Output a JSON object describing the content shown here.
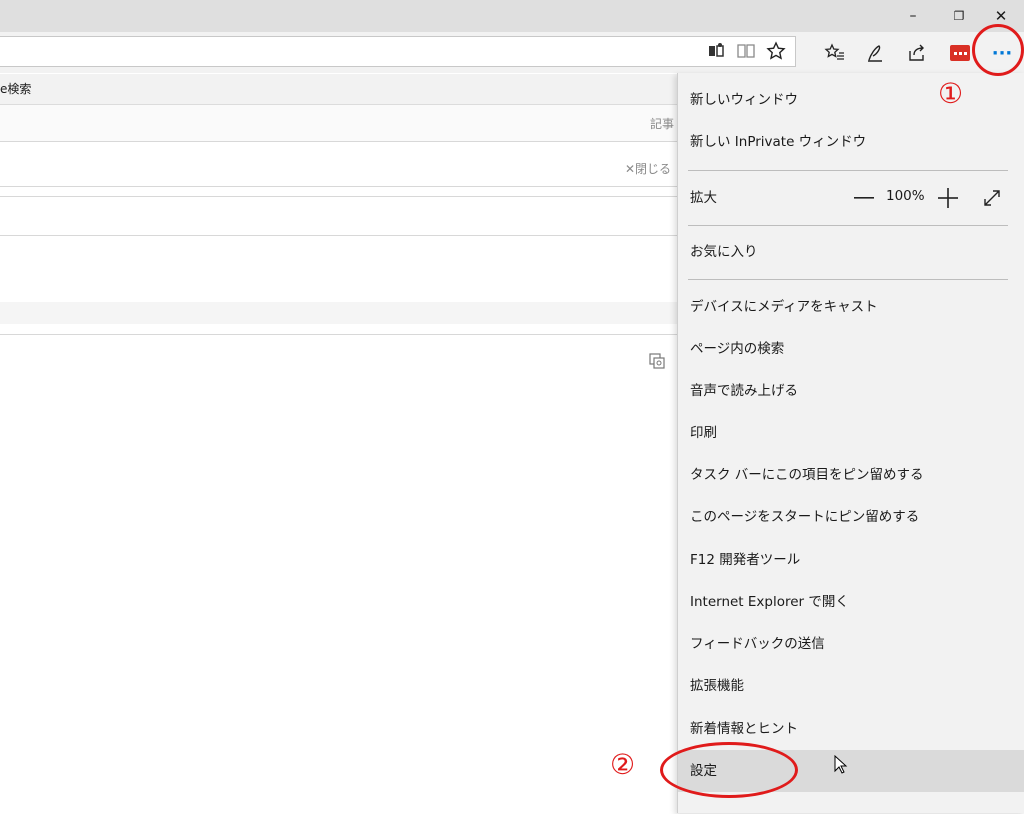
{
  "window": {
    "controls": {
      "minimize": "–",
      "restore": "❐",
      "close": "✕"
    }
  },
  "toolbar": {
    "more_label": "···",
    "icons": [
      "reading-view-icon",
      "book-icon",
      "favorite-star-icon",
      "favorites-list-icon",
      "pen-icon",
      "share-icon",
      "extension-icon",
      "more-icon"
    ]
  },
  "page": {
    "favbar_text": "e検索",
    "article_label": "記事",
    "close_label": "✕閉じる"
  },
  "menu": {
    "new_window": "新しいウィンドウ",
    "new_inprivate": "新しい InPrivate ウィンドウ",
    "zoom_label": "拡大",
    "zoom_value": "100%",
    "favorites": "お気に入り",
    "items": [
      "デバイスにメディアをキャスト",
      "ページ内の検索",
      "音声で読み上げる",
      "印刷",
      "タスク バーにこの項目をピン留めする",
      "このページをスタートにピン留めする",
      "F12 開発者ツール",
      "Internet Explorer で開く",
      "フィードバックの送信",
      "拡張機能",
      "新着情報とヒント",
      "設定"
    ]
  },
  "annotations": {
    "step1": "①",
    "step2": "②"
  },
  "colors": {
    "annotation": "#e01b1b",
    "menu_bg": "#f2f2f2",
    "accent_blue": "#0078d7"
  }
}
